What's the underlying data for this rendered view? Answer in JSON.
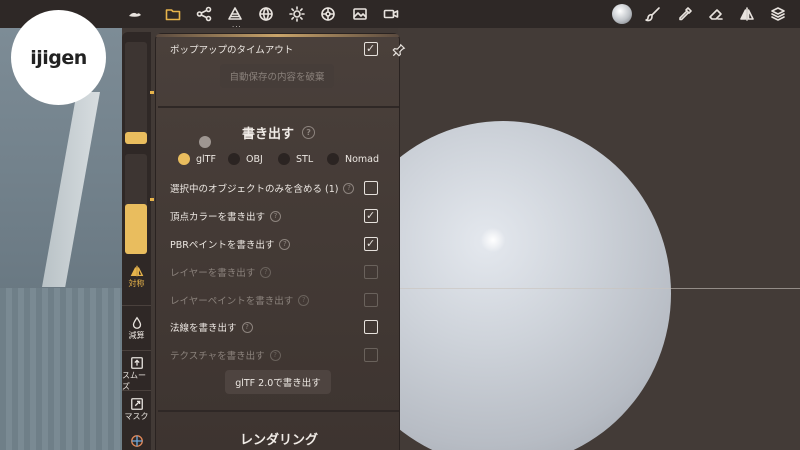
{
  "toolbar": {
    "left_icons": [
      "logo-icon",
      "folder-icon",
      "share-icon",
      "scene-icon",
      "globe-icon",
      "sun-icon",
      "aperture-icon",
      "image-icon",
      "video-icon"
    ],
    "right_icons": [
      "material-sphere-icon",
      "brush-icon",
      "eyedropper-icon",
      "eraser-icon",
      "symmetry-icon",
      "layers-icon"
    ],
    "dots": "···"
  },
  "logo": {
    "text": "ijigen"
  },
  "sidepanel": {
    "slider1_level": 0.12,
    "slider2_level": 0.5,
    "symmetry_label": "対称",
    "decimate_label": "減算",
    "smooth_label": "スムーズ",
    "mask_label": "マスク"
  },
  "panel": {
    "popup_timeout_label": "ポップアップのタイムアウト",
    "discard_autosave_label": "自動保存の内容を破棄",
    "export_title": "書き出す",
    "help_glyph": "?",
    "formats": [
      {
        "label": "glTF",
        "selected": true
      },
      {
        "label": "OBJ",
        "selected": false
      },
      {
        "label": "STL",
        "selected": false
      },
      {
        "label": "Nomad",
        "selected": false
      }
    ],
    "options": [
      {
        "label": "選択中のオブジェクトのみを含める (1)",
        "checked": false,
        "disabled": false
      },
      {
        "label": "頂点カラーを書き出す",
        "checked": true,
        "disabled": false
      },
      {
        "label": "PBRペイントを書き出す",
        "checked": true,
        "disabled": false
      },
      {
        "label": "レイヤーを書き出す",
        "checked": false,
        "disabled": true
      },
      {
        "label": "レイヤーペイントを書き出す",
        "checked": false,
        "disabled": true
      },
      {
        "label": "法線を書き出す",
        "checked": false,
        "disabled": false
      },
      {
        "label": "テクスチャを書き出す",
        "checked": false,
        "disabled": true
      }
    ],
    "export_button_label": "glTF 2.0で書き出す",
    "render_title": "レンダリング",
    "check_glyph": "✓"
  },
  "colors": {
    "accent": "#e6b34b",
    "panel": "#453b37",
    "topbar": "#2e2826"
  }
}
